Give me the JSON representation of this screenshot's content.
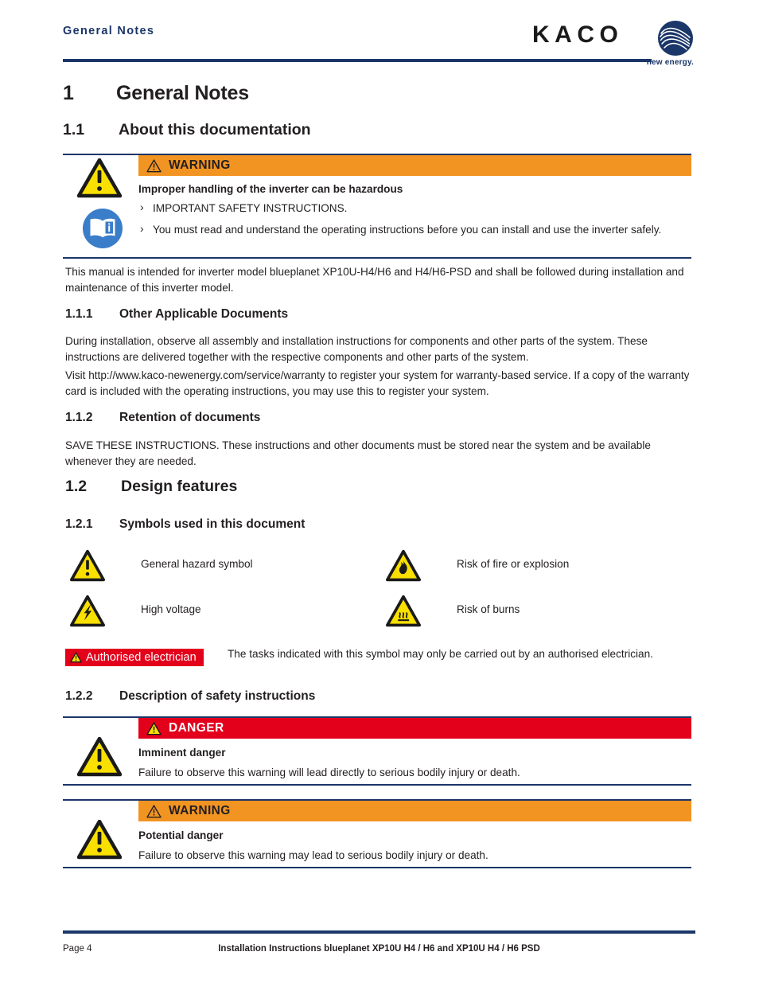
{
  "header": {
    "title": "General Notes",
    "logo_word": "KACO",
    "logo_tagline": "new energy.",
    "logo_mark_icon": "kaco-wave-mark-icon",
    "rule_color": "#1B3668"
  },
  "headings": {
    "h1_num": "1",
    "h1_text": "General Notes",
    "s11_num": "1.1",
    "s11_text": "About this documentation",
    "s111_num": "1.1.1",
    "s111_text": "Other Applicable Documents",
    "s112_num": "1.1.2",
    "s112_text": "Retention of documents",
    "s12_num": "1.2",
    "s12_text": "Design features",
    "s121_num": "1.2.1",
    "s121_text": "Symbols used in this document",
    "s122_num": "1.2.2",
    "s122_text": "Description of safety instructions"
  },
  "warning_top": {
    "bar_label": "WARNING",
    "bar_color": "#F29422",
    "bar_icon": "warning-triangle-icon",
    "side_icon_1": "general-hazard-triangle-icon",
    "side_icon_2": "read-manual-blue-icon",
    "subtitle": "Improper handling of the inverter can be hazardous",
    "bullets": [
      "IMPORTANT SAFETY INSTRUCTIONS.",
      "You must read and understand the operating instructions before you can install and use the inverter safely."
    ]
  },
  "intro_paragraph": "This manual is intended for inverter model blueplanet XP10U-H4/H6 and H4/H6-PSD and shall be followed during installation and maintenance of this inverter model.",
  "other_applicable_documents": {
    "p1": "During installation, observe all assembly and installation instructions for components and other parts of the system. These instructions are delivered together with the respective components and other parts of the system.",
    "p2": "Visit http://www.kaco-newenergy.com/service/warranty to register your system for warranty-based service. If a copy of the warranty card is included with the operating instructions, you may use this to register your system."
  },
  "retention_of_documents": {
    "p1": "SAVE THESE INSTRUCTIONS. These instructions and other documents must be stored near the system and be available whenever they are needed."
  },
  "symbols": [
    {
      "icon": "general-hazard-triangle-icon",
      "label": "General hazard symbol"
    },
    {
      "icon": "fire-explosion-triangle-icon",
      "label": "Risk of fire or explosion"
    },
    {
      "icon": "high-voltage-triangle-icon",
      "label": "High voltage"
    },
    {
      "icon": "hot-surface-burns-triangle-icon",
      "label": "Risk of burns"
    }
  ],
  "authorised_electrician": {
    "badge_label": "Authorised electrician",
    "badge_color": "#E3001B",
    "badge_icon": "warning-triangle-icon",
    "description": "The tasks indicated with this symbol may only be carried out by an authorised electrician."
  },
  "danger_box": {
    "bar_label": "DANGER",
    "bar_color": "#E3001B",
    "bar_icon": "warning-triangle-icon",
    "side_icon": "general-hazard-triangle-icon",
    "subtitle": "Imminent danger",
    "text": "Failure to observe this warning will lead directly to serious bodily injury or death."
  },
  "warning_box": {
    "bar_label": "WARNING",
    "bar_color": "#F29422",
    "bar_icon": "warning-triangle-icon",
    "side_icon": "general-hazard-triangle-icon",
    "subtitle": "Potential danger",
    "text": "Failure to observe this warning may lead to serious bodily injury or death."
  },
  "footer": {
    "page_label": "Page 4",
    "doc_title": "Installation Instructions blueplanet XP10U H4 / H6 and XP10U H4 / H6 PSD"
  }
}
